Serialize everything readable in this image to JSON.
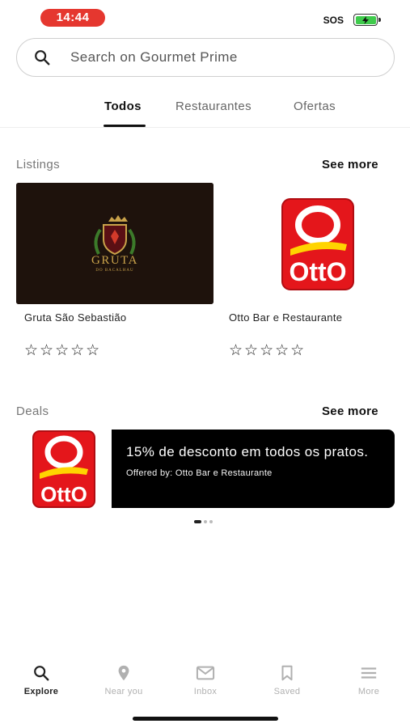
{
  "status_bar": {
    "time": "14:44",
    "sos": "SOS",
    "time_color": "#e5372f",
    "battery_color": "#3fcb4c"
  },
  "search": {
    "placeholder": "Search on Gourmet Prime",
    "value": ""
  },
  "tabs": [
    {
      "label": "Todos",
      "active": true
    },
    {
      "label": "Restaurantes",
      "active": false
    },
    {
      "label": "Ofertas",
      "active": false
    }
  ],
  "listings": {
    "title": "Listings",
    "see_more": "See more",
    "items": [
      {
        "name": "Gruta São Sebastião",
        "logo_text": "GRUTA",
        "logo_subtext": "DO BACALHAU",
        "rating": 0,
        "stars": "☆☆☆☆☆"
      },
      {
        "name": "Otto Bar e Restaurante",
        "logo_text": "OttO",
        "rating": 0,
        "stars": "☆☆☆☆☆"
      }
    ]
  },
  "deals": {
    "title": "Deals",
    "see_more": "See more",
    "items": [
      {
        "title": "15% de desconto em todos os pratos.",
        "offered_by": "Offered by: Otto Bar e Restaurante",
        "logo_text": "OttO"
      }
    ],
    "pager": {
      "count": 3,
      "active_index": 0
    }
  },
  "bottom_nav": [
    {
      "label": "Explore",
      "icon": "search-icon",
      "active": true
    },
    {
      "label": "Near you",
      "icon": "location-pin-icon",
      "active": false
    },
    {
      "label": "Inbox",
      "icon": "mail-icon",
      "active": false
    },
    {
      "label": "Saved",
      "icon": "bookmark-icon",
      "active": false
    },
    {
      "label": "More",
      "icon": "menu-icon",
      "active": false
    }
  ],
  "colors": {
    "otto_red": "#e4161b",
    "otto_yellow": "#ffd400",
    "gruta_bg": "#1e120c",
    "gruta_gold": "#c9a24a",
    "deal_bg": "#000000"
  }
}
